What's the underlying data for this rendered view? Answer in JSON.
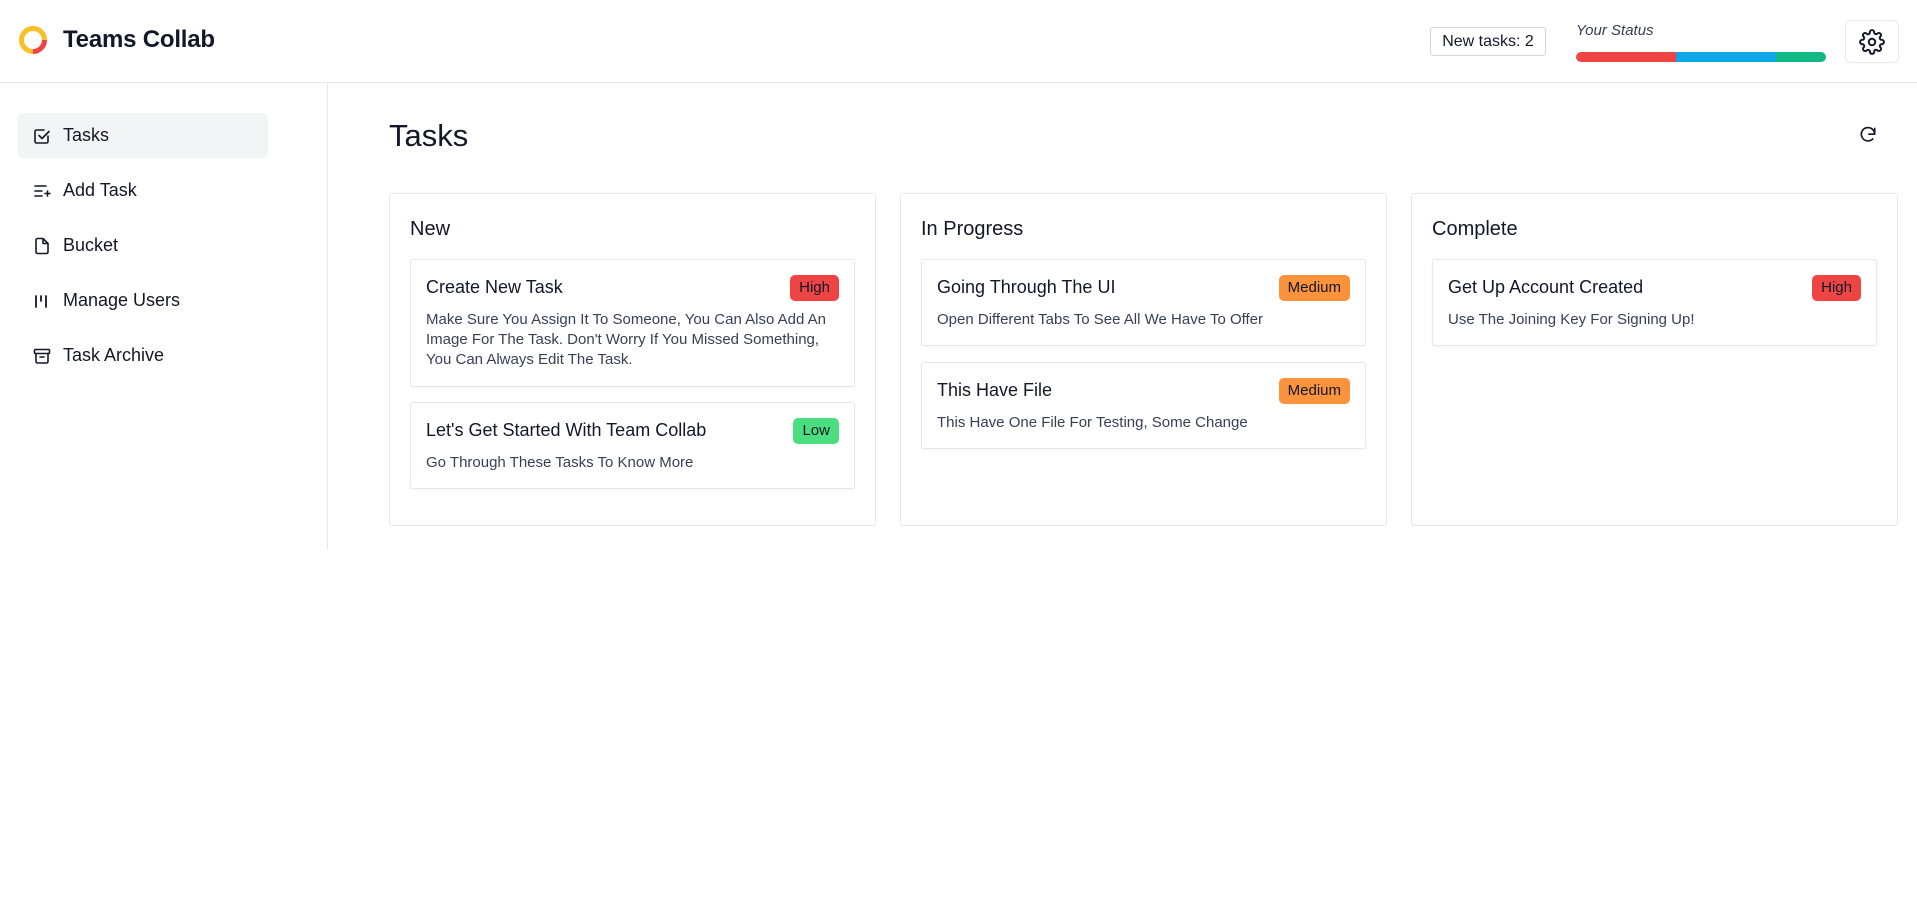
{
  "app": {
    "name": "Teams Collab"
  },
  "header": {
    "new_tasks_label": "New tasks: 2",
    "status_label": "Your Status",
    "status_segments": [
      {
        "color": "#ef4444",
        "fraction": 0.4
      },
      {
        "color": "#0ea5e9",
        "fraction": 0.4
      },
      {
        "color": "#10b981",
        "fraction": 0.2
      }
    ],
    "settings_icon": "gear-icon"
  },
  "sidebar": {
    "items": [
      {
        "label": "Tasks",
        "icon": "checkbox-icon",
        "active": true
      },
      {
        "label": "Add Task",
        "icon": "list-add-icon",
        "active": false
      },
      {
        "label": "Bucket",
        "icon": "file-icon",
        "active": false
      },
      {
        "label": "Manage Users",
        "icon": "users-bars-icon",
        "active": false
      },
      {
        "label": "Task Archive",
        "icon": "archive-icon",
        "active": false
      }
    ]
  },
  "main": {
    "title": "Tasks",
    "refresh_icon": "refresh-icon",
    "columns": [
      {
        "title": "New",
        "cards": [
          {
            "title": "Create New Task",
            "priority": "High",
            "description": "Make Sure You Assign It To Someone, You Can Also Add An Image For The Task. Don't Worry If You Missed Something, You Can Always Edit The Task."
          },
          {
            "title": "Let's Get Started With Team Collab",
            "priority": "Low",
            "description": "Go Through These Tasks To Know More"
          }
        ]
      },
      {
        "title": "In Progress",
        "cards": [
          {
            "title": "Going Through The UI",
            "priority": "Medium",
            "description": "Open Different Tabs To See All We Have To Offer"
          },
          {
            "title": "This Have File",
            "priority": "Medium",
            "description": "This Have One File For Testing, Some Change"
          }
        ]
      },
      {
        "title": "Complete",
        "cards": [
          {
            "title": "Get Up Account Created",
            "priority": "High",
            "description": "Use The Joining Key For Signing Up!"
          }
        ]
      }
    ]
  },
  "priority_colors": {
    "High": "#ef4444",
    "Medium": "#fb923c",
    "Low": "#4ade80"
  }
}
